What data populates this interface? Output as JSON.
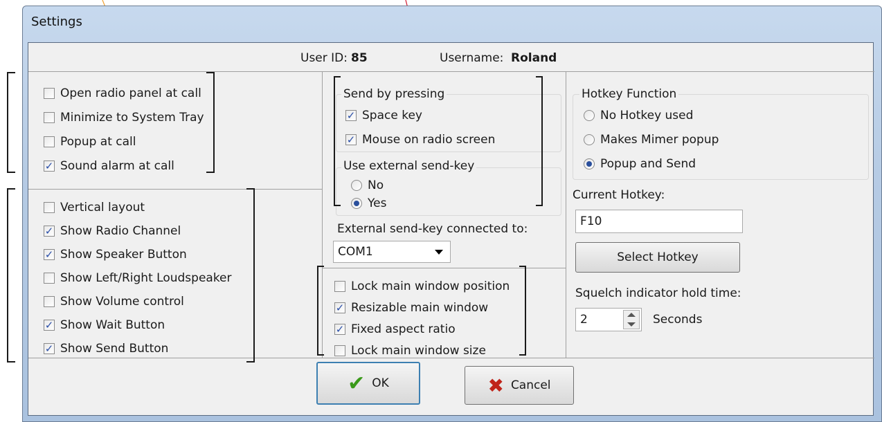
{
  "window": {
    "title": "Settings"
  },
  "header": {
    "user_id_label": "User ID:",
    "user_id_value": "85",
    "username_label": "Username:",
    "username_value": "Roland"
  },
  "general_options": [
    {
      "label": "Open radio panel at call",
      "checked": false
    },
    {
      "label": "Minimize to System Tray",
      "checked": false
    },
    {
      "label": "Popup at call",
      "checked": false
    },
    {
      "label": "Sound alarm at call",
      "checked": true
    }
  ],
  "layout_options": [
    {
      "label": "Vertical layout",
      "checked": false
    },
    {
      "label": "Show Radio Channel",
      "checked": true
    },
    {
      "label": "Show Speaker Button",
      "checked": true
    },
    {
      "label": "Show Left/Right Loudspeaker",
      "checked": false
    },
    {
      "label": "Show Volume control",
      "checked": false
    },
    {
      "label": "Show Wait Button",
      "checked": true
    },
    {
      "label": "Show Send Button",
      "checked": true
    }
  ],
  "send_by_pressing": {
    "legend": "Send by pressing",
    "options": [
      {
        "label": "Space key",
        "checked": true
      },
      {
        "label": "Mouse on radio screen",
        "checked": true
      }
    ]
  },
  "external_send_key": {
    "legend": "Use external send-key",
    "options": [
      {
        "label": "No",
        "selected": false
      },
      {
        "label": "Yes",
        "selected": true
      }
    ],
    "connected_label": "External send-key connected to:",
    "port_value": "COM1"
  },
  "window_options": [
    {
      "label": "Lock main window position",
      "checked": false
    },
    {
      "label": "Resizable main window",
      "checked": true
    },
    {
      "label": "Fixed aspect ratio",
      "checked": true
    },
    {
      "label": "Lock main window size",
      "checked": false
    }
  ],
  "hotkey_function": {
    "legend": "Hotkey Function",
    "options": [
      {
        "label": "No Hotkey used",
        "selected": false
      },
      {
        "label": "Makes Mimer popup",
        "selected": false
      },
      {
        "label": "Popup and Send",
        "selected": true
      }
    ]
  },
  "current_hotkey": {
    "label": "Current Hotkey:",
    "value": "F10",
    "select_button": "Select Hotkey"
  },
  "squelch": {
    "label": "Squelch indicator hold time:",
    "value": "2",
    "unit": "Seconds"
  },
  "buttons": {
    "ok": "OK",
    "cancel": "Cancel"
  },
  "colors": {
    "check": "#2b4fa8",
    "orange_marker": "#f0a030",
    "red_marker": "#d0182f"
  }
}
